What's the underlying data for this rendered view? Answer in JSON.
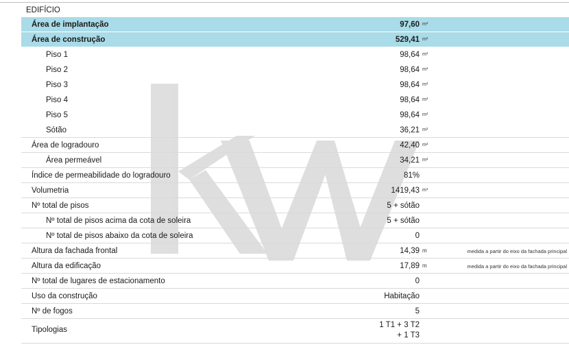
{
  "section_title": "EDIFÍCIO",
  "watermark_text": "KW",
  "rows": [
    {
      "label": "Área de implantação",
      "value": "97,60",
      "unit": "m²",
      "style": "highlight"
    },
    {
      "label": "Área de construção",
      "value": "529,41",
      "unit": "m²",
      "style": "highlight"
    },
    {
      "label": "Piso 1",
      "value": "98,64",
      "unit": "m²",
      "indent": true,
      "line": false
    },
    {
      "label": "Piso 2",
      "value": "98,64",
      "unit": "m²",
      "indent": true,
      "line": false
    },
    {
      "label": "Piso 3",
      "value": "98,64",
      "unit": "m²",
      "indent": true,
      "line": false
    },
    {
      "label": "Piso 4",
      "value": "98,64",
      "unit": "m²",
      "indent": true,
      "line": false
    },
    {
      "label": "Piso 5",
      "value": "98,64",
      "unit": "m²",
      "indent": true,
      "line": false
    },
    {
      "label": "Sótão",
      "value": "36,21",
      "unit": "m²",
      "indent": true
    },
    {
      "label": "Área de logradouro",
      "value": "42,40",
      "unit": "m²"
    },
    {
      "label": "Área permeável",
      "value": "34,21",
      "unit": "m²",
      "indent": true
    },
    {
      "label": "Índice de permeabilidade do logradouro",
      "value": "81%"
    },
    {
      "label": "Volumetria",
      "value": "1419,43",
      "unit": "m³"
    },
    {
      "label": "Nº total de pisos",
      "value": "5 + sótão"
    },
    {
      "label": "Nº total de pisos acima da cota de soleira",
      "value": "5 + sótão",
      "indent": true
    },
    {
      "label": "Nº total de pisos abaixo da cota de soleira",
      "value": "0",
      "indent": true
    },
    {
      "label": "Altura da fachada frontal",
      "value": "14,39",
      "unit": "m",
      "note": "medida a partir do eixo da fachada principal"
    },
    {
      "label": "Altura da edificação",
      "value": "17,89",
      "unit": "m",
      "note": "medida a partir do eixo da fachada principal"
    },
    {
      "label": "Nº total de lugares de estacionamento",
      "value": "0"
    },
    {
      "label": "Uso da construção",
      "value": "Habitação"
    },
    {
      "label": "Nº de fogos",
      "value": "5"
    },
    {
      "label": "Tipologias",
      "value_lines": [
        "1 T1 + 3 T2",
        "+ 1 T3"
      ],
      "tall": true
    }
  ],
  "colors": {
    "highlight": "#a9dbe8",
    "watermark": "#d9d9d9"
  }
}
